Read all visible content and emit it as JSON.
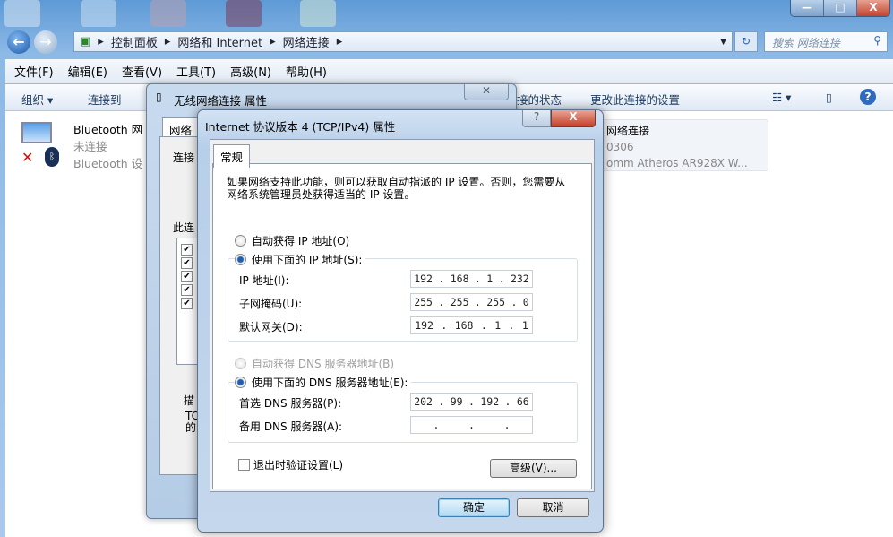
{
  "explorer": {
    "breadcrumb": [
      "控制面板",
      "网络和 Internet",
      "网络连接"
    ],
    "search_placeholder": "搜索 网络连接",
    "window_controls": {
      "minimize": "—",
      "maximize": "□",
      "close": "X"
    },
    "menu": [
      "文件(F)",
      "编辑(E)",
      "查看(V)",
      "工具(T)",
      "高级(N)",
      "帮助(H)"
    ],
    "toolbar": {
      "organize": "组织 ▾",
      "connect_to": "连接到",
      "status": "接的状态",
      "change_settings": "更改此连接的设置"
    },
    "connections": [
      {
        "name": "Bluetooth 网",
        "status": "未连接",
        "device": "Bluetooth 设"
      },
      {
        "name": "网络连接",
        "status": "0306",
        "device": "omm Atheros AR928X W..."
      }
    ]
  },
  "wireless_dialog": {
    "title": "无线网络连接 属性",
    "tab": "网络",
    "connect_label": "连接",
    "items_label": "此连",
    "desc_label": "描",
    "desc_text": [
      "TC",
      "的"
    ]
  },
  "tcp_dialog": {
    "title": "Internet 协议版本 4 (TCP/IPv4) 属性",
    "tab": "常规",
    "intro": "如果网络支持此功能，则可以获取自动指派的 IP 设置。否则，您需要从网络系统管理员处获得适当的 IP 设置。",
    "auto_ip": "自动获得 IP 地址(O)",
    "manual_ip": "使用下面的 IP 地址(S):",
    "ip_mode": "manual",
    "fields": [
      {
        "label": "IP 地址(I):",
        "octets": [
          "192",
          "168",
          "1",
          "232"
        ]
      },
      {
        "label": "子网掩码(U):",
        "octets": [
          "255",
          "255",
          "255",
          "0"
        ]
      },
      {
        "label": "默认网关(D):",
        "octets": [
          "192",
          "168",
          "1",
          "1"
        ]
      }
    ],
    "auto_dns": "自动获得 DNS 服务器地址(B)",
    "manual_dns": "使用下面的 DNS 服务器地址(E):",
    "dns_fields": [
      {
        "label": "首选 DNS 服务器(P):",
        "octets": [
          "202",
          "99",
          "192",
          "66"
        ]
      },
      {
        "label": "备用 DNS 服务器(A):",
        "octets": [
          "",
          "",
          "",
          ""
        ]
      }
    ],
    "validate_on_exit": "退出时验证设置(L)",
    "validate_checked": false,
    "advanced": "高级(V)...",
    "ok": "确定",
    "cancel": "取消",
    "help": "?",
    "close": "X"
  }
}
